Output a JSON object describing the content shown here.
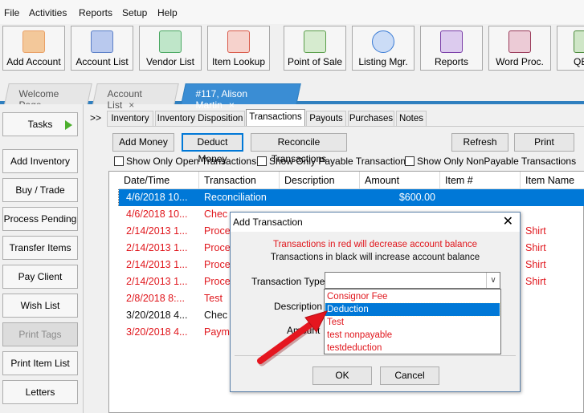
{
  "menu": [
    "File",
    "Activities",
    "Reports",
    "Setup",
    "Help"
  ],
  "toolbar": [
    {
      "label": "Add Account",
      "icon": "add-account-icon",
      "color": "#e9a066"
    },
    {
      "label": "Account List",
      "icon": "account-list-icon",
      "color": "#5b7fc8"
    },
    {
      "label": "Vendor List",
      "icon": "vendor-list-icon",
      "color": "#4aa862"
    },
    {
      "label": "Item Lookup",
      "icon": "item-lookup-icon",
      "color": "#d95a4a"
    },
    {
      "label": "Point of Sale",
      "icon": "point-of-sale-icon",
      "color": "#5a9e4a"
    },
    {
      "label": "Listing Mgr.",
      "icon": "listing-manager-icon",
      "color": "#3a7bd5"
    },
    {
      "label": "Reports",
      "icon": "reports-icon",
      "color": "#7a3da8"
    },
    {
      "label": "Word Proc.",
      "icon": "word-processor-icon",
      "color": "#9a3a5a"
    },
    {
      "label": "QB",
      "icon": "quickbooks-icon",
      "color": "#4a8a3a"
    }
  ],
  "doc_tabs": [
    {
      "label": "Welcome Page",
      "closable": false,
      "active": false
    },
    {
      "label": "Account List",
      "closable": true,
      "active": false
    },
    {
      "label": "#117, Alison Martin",
      "closable": true,
      "active": true
    }
  ],
  "sidebar": [
    {
      "label": "Tasks",
      "disabled": false,
      "arrow": true
    },
    {
      "label": "Add Inventory",
      "disabled": false
    },
    {
      "label": "Buy / Trade",
      "disabled": false
    },
    {
      "label": "Process Pending",
      "disabled": false
    },
    {
      "label": "Transfer Items",
      "disabled": false
    },
    {
      "label": "Pay Client",
      "disabled": false
    },
    {
      "label": "Wish List",
      "disabled": false
    },
    {
      "label": "Print Tags",
      "disabled": true
    },
    {
      "label": "Print Item List",
      "disabled": false
    },
    {
      "label": "Letters",
      "disabled": false
    }
  ],
  "inner_tabs_chevron": ">>",
  "inner_tabs": [
    {
      "label": "Inventory",
      "active": false
    },
    {
      "label": "Inventory Disposition",
      "active": false
    },
    {
      "label": "Transactions",
      "active": true
    },
    {
      "label": "Payouts",
      "active": false
    },
    {
      "label": "Purchases",
      "active": false
    },
    {
      "label": "Notes",
      "active": false
    }
  ],
  "actions": {
    "add_money": "Add Money",
    "deduct_money": "Deduct Money",
    "reconcile": "Reconcile Transactions",
    "refresh": "Refresh",
    "print": "Print"
  },
  "filters": {
    "open_only": "Show Only Open Transactions",
    "payable_only": "Show Only Payable Transactions",
    "nonpayable_only": "Show Only NonPayable Transactions"
  },
  "grid": {
    "columns": [
      "Date/Time",
      "Transaction",
      "Description",
      "Amount",
      "Item #",
      "Item Name"
    ],
    "rows": [
      {
        "date": "4/6/2018 10...",
        "transaction": "Reconciliation",
        "description": "",
        "amount": "$600.00",
        "item": "",
        "item_name": "",
        "style": "sel"
      },
      {
        "date": "4/6/2018 10...",
        "transaction": "Chec",
        "description": "",
        "amount": "",
        "item": "",
        "item_name": "",
        "style": "red"
      },
      {
        "date": "2/14/2013 1...",
        "transaction": "Proce",
        "description": "",
        "amount": "",
        "item": "",
        "item_name": "Shirt",
        "style": "red"
      },
      {
        "date": "2/14/2013 1...",
        "transaction": "Proce",
        "description": "",
        "amount": "",
        "item": "",
        "item_name": "Shirt",
        "style": "red"
      },
      {
        "date": "2/14/2013 1...",
        "transaction": "Proce",
        "description": "",
        "amount": "",
        "item": "",
        "item_name": "Shirt",
        "style": "red"
      },
      {
        "date": "2/14/2013 1...",
        "transaction": "Proce",
        "description": "",
        "amount": "",
        "item": "",
        "item_name": "Shirt",
        "style": "red"
      },
      {
        "date": "2/8/2018 8:...",
        "transaction": "Test",
        "description": "",
        "amount": "",
        "item": "",
        "item_name": "",
        "style": "red"
      },
      {
        "date": "3/20/2018 4...",
        "transaction": "Chec",
        "description": "",
        "amount": "",
        "item": "",
        "item_name": "",
        "style": "black"
      },
      {
        "date": "3/20/2018 4...",
        "transaction": "Paym",
        "description": "",
        "amount": "",
        "item": "",
        "item_name": "",
        "style": "red"
      }
    ]
  },
  "dialog": {
    "title": "Add Transaction",
    "close": "✕",
    "note_red": "Transactions in red will decrease account balance",
    "note_black": "Transactions in black will increase account balance",
    "type_label": "Transaction Type",
    "type_value": "",
    "description_label": "Description",
    "amount_label": "Amount",
    "ok": "OK",
    "cancel": "Cancel"
  },
  "dropdown_options": [
    {
      "label": "Consignor Fee",
      "highlighted": false
    },
    {
      "label": "Deduction",
      "highlighted": true
    },
    {
      "label": "Test",
      "highlighted": false
    },
    {
      "label": "test nonpayable",
      "highlighted": false
    },
    {
      "label": "testdeduction",
      "highlighted": false
    }
  ],
  "colors": {
    "accent": "#0078d7",
    "tab_blue": "#3a8dd4",
    "red_text": "#e0161c",
    "annotation_arrow": "#e5161f"
  }
}
